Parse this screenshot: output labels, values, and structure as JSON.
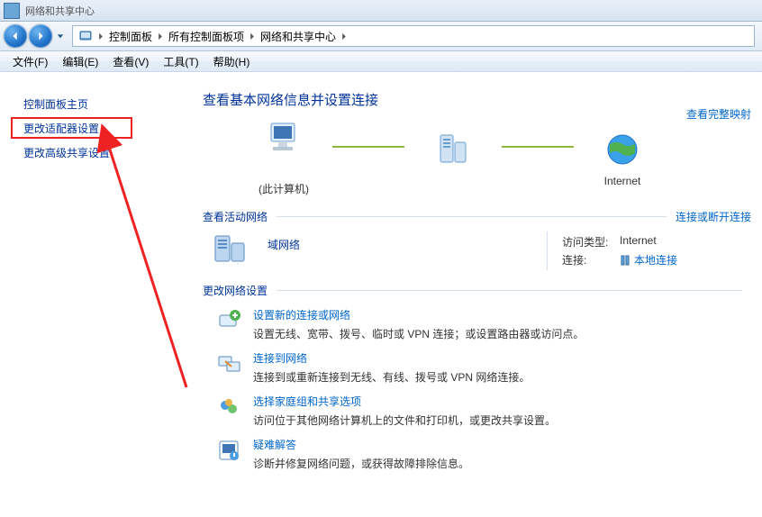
{
  "window": {
    "title": "网络和共享中心"
  },
  "nav": {
    "breadcrumbs": [
      "控制面板",
      "所有控制面板项",
      "网络和共享中心"
    ]
  },
  "menu": {
    "file": "文件(F)",
    "edit": "编辑(E)",
    "view": "查看(V)",
    "tools": "工具(T)",
    "help": "帮助(H)"
  },
  "sidebar": {
    "home": "控制面板主页",
    "adapter": "更改适配器设置",
    "sharing": "更改高级共享设置"
  },
  "main": {
    "title": "查看基本网络信息并设置连接",
    "full_map": "查看完整映射",
    "topo": {
      "this_pc": "(此计算机)",
      "internet": "Internet"
    },
    "active_head": "查看活动网络",
    "active_link": "连接或断开连接",
    "network": {
      "name": "域网络",
      "access_k": "访问类型:",
      "access_v": "Internet",
      "conn_k": "连接:",
      "conn_v": "本地连接"
    },
    "settings_head": "更改网络设置",
    "tasks": [
      {
        "title": "设置新的连接或网络",
        "desc": "设置无线、宽带、拨号、临时或 VPN 连接；或设置路由器或访问点。"
      },
      {
        "title": "连接到网络",
        "desc": "连接到或重新连接到无线、有线、拨号或 VPN 网络连接。"
      },
      {
        "title": "选择家庭组和共享选项",
        "desc": "访问位于其他网络计算机上的文件和打印机，或更改共享设置。"
      },
      {
        "title": "疑难解答",
        "desc": "诊断并修复网络问题，或获得故障排除信息。"
      }
    ]
  }
}
